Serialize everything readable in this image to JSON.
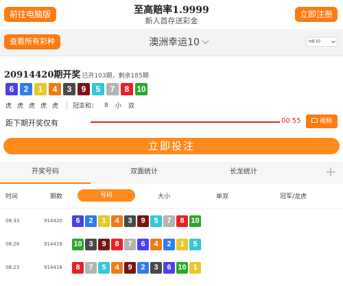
{
  "header": {
    "pc_button": "前往电脑版",
    "title": "至高赔率1.9999",
    "subtitle": "新人首存送彩金",
    "register_button": "立即注册"
  },
  "selector": {
    "all_lotteries_button": "查看所有彩种",
    "lottery_name": "澳洲幸运10",
    "mini_select_value": "m8 10"
  },
  "draw": {
    "issue": "20914420期开奖",
    "progress": "已开103期，剩余185期",
    "numbers": [
      "6",
      "2",
      "1",
      "4",
      "3",
      "9",
      "5",
      "7",
      "8",
      "10"
    ],
    "zodiacs": [
      "虎",
      "虎",
      "虎",
      "虎",
      "虎"
    ],
    "guanya_label": "冠亚和：",
    "guanya_sum": "8",
    "guanya_size": "小",
    "guanya_oddeven": "双"
  },
  "countdown": {
    "label": "距下期开奖仅有",
    "time": "00 55",
    "video_button": "视频"
  },
  "bet_button": "立即投注",
  "tabs": [
    "开奖号码",
    "双面统计",
    "长龙统计"
  ],
  "columns": {
    "time": "时间",
    "issue": "期数",
    "number": "号码",
    "big_small": "大小",
    "odd_even": "单双",
    "dragon_tiger": "冠军/龙虎"
  },
  "history": [
    {
      "time": "08:33",
      "issue": "914420",
      "numbers": [
        "6",
        "2",
        "1",
        "4",
        "3",
        "9",
        "5",
        "7",
        "8",
        "10"
      ]
    },
    {
      "time": "08:28",
      "issue": "914419",
      "numbers": [
        "10",
        "3",
        "9",
        "8",
        "7",
        "6",
        "4",
        "2",
        "1",
        "5"
      ]
    },
    {
      "time": "08:23",
      "issue": "914418",
      "numbers": [
        "8",
        "7",
        "5",
        "4",
        "9",
        "2",
        "3",
        "6",
        "10",
        "1"
      ]
    }
  ],
  "colors": {
    "accent": "#ff7a12",
    "countdown_red": "#e8201a",
    "ball_1": "#e6c92a",
    "ball_2": "#2f7cf0",
    "ball_3": "#4a4a4a",
    "ball_4": "#f07a1a",
    "ball_5": "#35c7d8",
    "ball_6": "#4b3ff0",
    "ball_7": "#b3b3b3",
    "ball_8": "#e8202a",
    "ball_9": "#7a1414",
    "ball_10": "#2aa82a"
  }
}
